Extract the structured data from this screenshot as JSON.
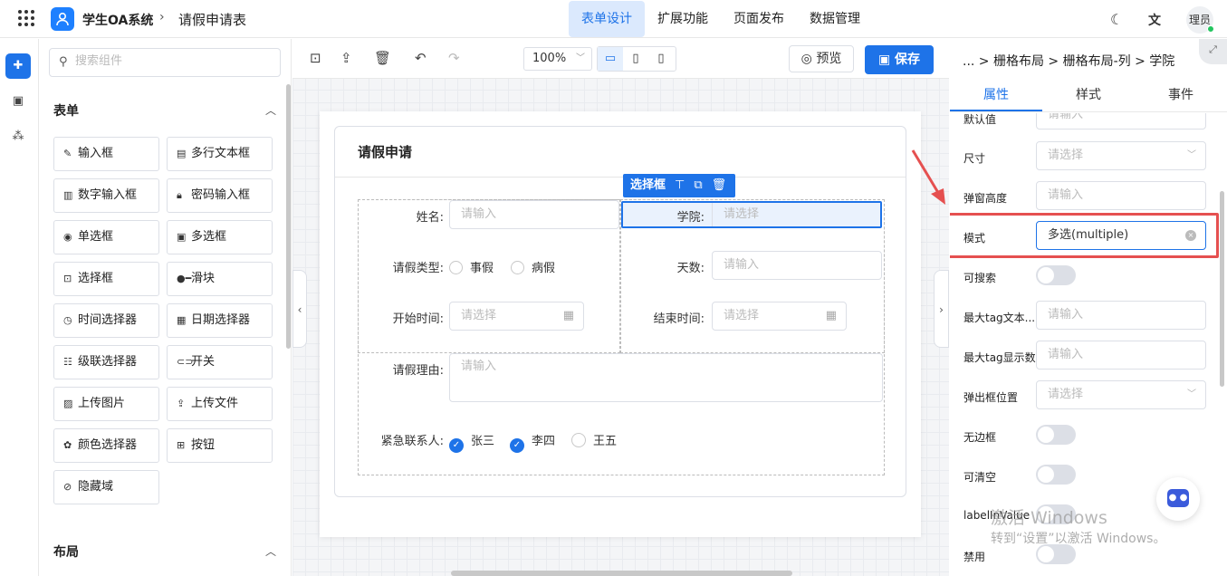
{
  "header": {
    "app_name": "学生OA系统",
    "page_name": "请假申请表",
    "nav": [
      "表单设计",
      "扩展功能",
      "页面发布",
      "数据管理"
    ],
    "active_nav": "表单设计",
    "user": "理员",
    "icons": [
      "apps-grid-icon",
      "user-logo-icon",
      "moon-icon",
      "translate-icon"
    ]
  },
  "left_rail": {
    "icons": [
      "puzzle-icon",
      "code-icon",
      "tree-icon"
    ]
  },
  "components": {
    "search_placeholder": "搜索组件",
    "section_form": "表单",
    "items": [
      {
        "label": "输入框",
        "icon": "pencil-icon"
      },
      {
        "label": "多行文本框",
        "icon": "textarea-icon"
      },
      {
        "label": "数字输入框",
        "icon": "number-icon"
      },
      {
        "label": "密码输入框",
        "icon": "lock-icon"
      },
      {
        "label": "单选框",
        "icon": "radio-icon"
      },
      {
        "label": "多选框",
        "icon": "checkbox-icon"
      },
      {
        "label": "选择框",
        "icon": "select-icon"
      },
      {
        "label": "滑块",
        "icon": "slider-icon"
      },
      {
        "label": "时间选择器",
        "icon": "clock-icon"
      },
      {
        "label": "日期选择器",
        "icon": "calendar-icon"
      },
      {
        "label": "级联选择器",
        "icon": "cascader-icon"
      },
      {
        "label": "开关",
        "icon": "switch-icon"
      },
      {
        "label": "上传图片",
        "icon": "image-icon"
      },
      {
        "label": "上传文件",
        "icon": "upload-icon"
      },
      {
        "label": "颜色选择器",
        "icon": "palette-icon"
      },
      {
        "label": "按钮",
        "icon": "button-icon"
      },
      {
        "label": "隐藏域",
        "icon": "eye-off-icon"
      }
    ],
    "section_layout": "布局"
  },
  "toolbar": {
    "zoom": "100%",
    "preview": "预览",
    "save": "保存"
  },
  "form": {
    "title": "请假申请",
    "selected_tag": "选择框",
    "name_label": "姓名:",
    "name_placeholder": "请输入",
    "college_label": "学院:",
    "college_placeholder": "请选择",
    "type_label": "请假类型:",
    "type_options": [
      "事假",
      "病假"
    ],
    "days_label": "天数:",
    "days_placeholder": "请输入",
    "start_label": "开始时间:",
    "start_placeholder": "请选择",
    "end_label": "结束时间:",
    "end_placeholder": "请选择",
    "reason_label": "请假理由:",
    "reason_placeholder": "请输入",
    "contact_label": "紧急联系人:",
    "contacts": [
      {
        "name": "张三",
        "checked": true
      },
      {
        "name": "李四",
        "checked": true
      },
      {
        "name": "王五",
        "checked": false
      }
    ]
  },
  "properties": {
    "breadcrumb": "... > 栅格布局 > 栅格布局-列 > 学院",
    "tabs": [
      "属性",
      "样式",
      "事件"
    ],
    "active_tab": "属性",
    "rows": [
      {
        "label": "默认值",
        "kind": "input",
        "placeholder": "请输入"
      },
      {
        "label": "尺寸",
        "kind": "select",
        "placeholder": "请选择"
      },
      {
        "label": "弹窗高度",
        "kind": "input",
        "placeholder": "请输入"
      },
      {
        "label": "模式",
        "kind": "value",
        "value": "多选(multiple)"
      },
      {
        "label": "可搜索",
        "kind": "switch"
      },
      {
        "label": "最大tag文本...",
        "kind": "input",
        "placeholder": "请输入"
      },
      {
        "label": "最大tag显示数",
        "kind": "input",
        "placeholder": "请输入"
      },
      {
        "label": "弹出框位置",
        "kind": "select",
        "placeholder": "请选择"
      },
      {
        "label": "无边框",
        "kind": "switch"
      },
      {
        "label": "可清空",
        "kind": "switch"
      },
      {
        "label": "labelInValue",
        "kind": "switch"
      },
      {
        "label": "禁用",
        "kind": "switch"
      }
    ]
  },
  "watermark": {
    "line1": "激活 Windows",
    "line2": "转到“设置”以激活 Windows。"
  },
  "colors": {
    "accent": "#1e73e8",
    "highlight": "#e55050"
  }
}
